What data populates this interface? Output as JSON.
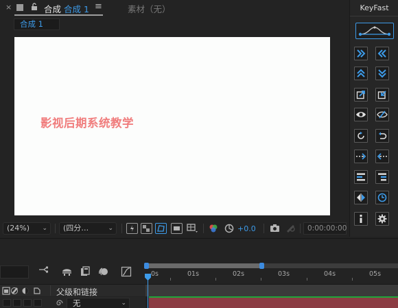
{
  "comp_tab": {
    "label_prefix": "合成",
    "label_comp": "合成 1",
    "menu_glyph": "≡",
    "footage_label": "素材（无）",
    "subtab_label": "合成 1"
  },
  "viewer": {
    "overlay_text": "影视后期系统教学",
    "overlay_color": "#f07d7d",
    "background_color": "#fcfdfc"
  },
  "viewer_toolbar": {
    "magnification": "(24%)",
    "resolution": "(四分…",
    "exposure_value": "+0.0",
    "timecode": "0:00:00:00"
  },
  "keyfast": {
    "title": "KeyFast",
    "accent_color": "#3d9be9",
    "buttons": [
      "fast-forward-icon",
      "rewind-icon",
      "chevron-up-icon",
      "chevron-down-icon",
      "export-arrow-icon",
      "edit-arrow-icon",
      "eye-icon",
      "eye-off-icon",
      "rotate-cw-icon",
      "undo-icon",
      "arrow-right-dotted-icon",
      "arrow-left-dotted-icon",
      "align-left-icon",
      "align-right-icon",
      "flip-horizontal-icon",
      "clock-icon",
      "info-icon",
      "gear-icon"
    ]
  },
  "timeline": {
    "ticks": [
      "0s",
      "01s",
      "02s",
      "03s",
      "04s",
      "05s"
    ],
    "parent_header": "父级和链接",
    "parent_value": "无"
  }
}
